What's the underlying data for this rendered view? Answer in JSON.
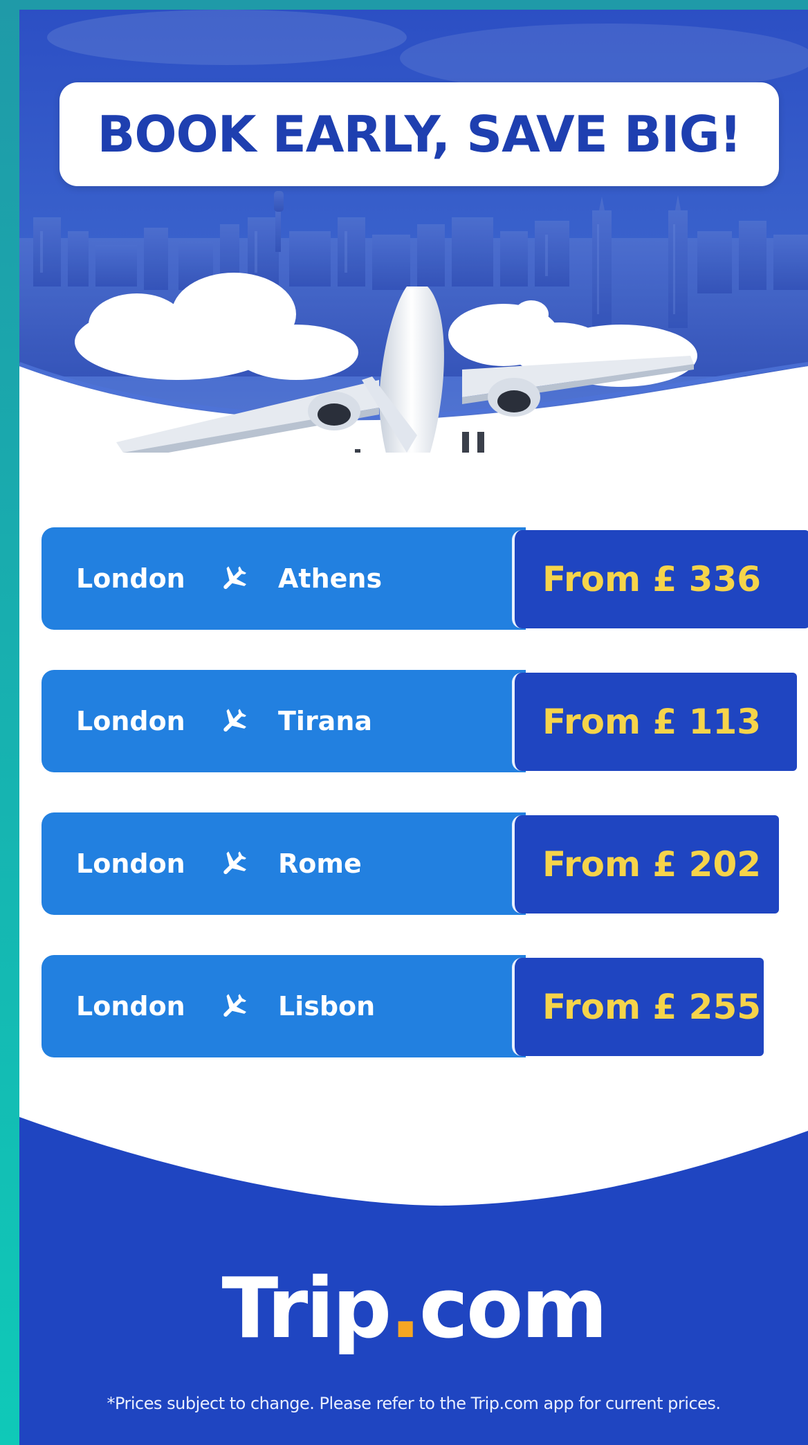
{
  "headline": "BOOK EARLY, SAVE BIG!",
  "routes": [
    {
      "from": "London",
      "to": "Athens",
      "price": "From £ 336"
    },
    {
      "from": "London",
      "to": "Tirana",
      "price": "From £ 113"
    },
    {
      "from": "London",
      "to": "Rome",
      "price": "From £ 202"
    },
    {
      "from": "London",
      "to": "Lisbon",
      "price": "From £ 255"
    }
  ],
  "brand": {
    "name_part1": "Trip",
    "dot": ".",
    "name_part2": "com"
  },
  "disclaimer": "*Prices subject to change. Please refer to the Trip.com app for current prices.",
  "colors": {
    "brand_blue": "#1f45c1",
    "route_blue": "#2280e0",
    "price_yellow": "#f6d44a",
    "logo_dot": "#f5a623",
    "frame_teal": "#0fc9b8"
  },
  "icons": {
    "route_separator": "airplane-icon"
  }
}
